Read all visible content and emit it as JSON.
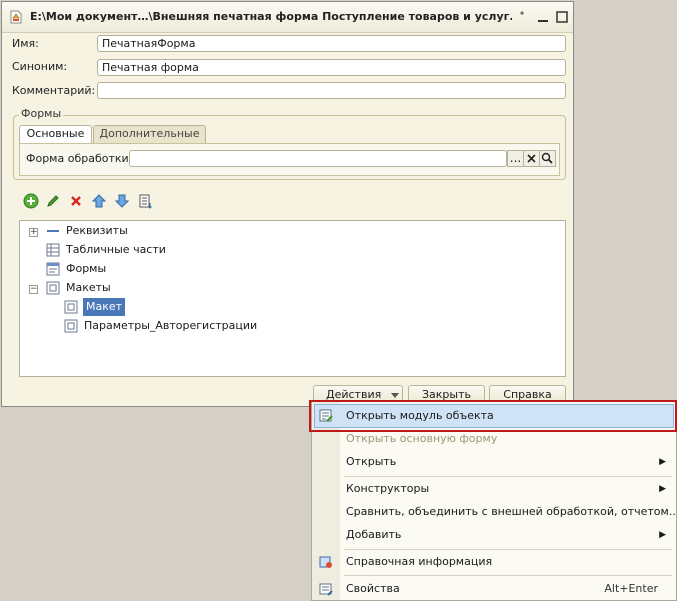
{
  "window": {
    "title": "E:\\Мои документ…\\Внешняя печатная форма Поступление товаров и услуг.epf *"
  },
  "fields": {
    "name_label": "Имя:",
    "name_value": "ПечатнаяФорма",
    "synonym_label": "Синоним:",
    "synonym_value": "Печатная форма",
    "comment_label": "Комментарий:",
    "comment_value": ""
  },
  "forms_group": {
    "title": "Формы",
    "tabs": [
      {
        "label": "Основные"
      },
      {
        "label": "Дополнительные"
      }
    ],
    "processing_form_label": "Форма обработки:",
    "processing_form_value": "",
    "select_button": "...",
    "clear_button": "✕",
    "open_button": "🔍"
  },
  "toolbar": {
    "icons": [
      "add-icon",
      "edit-icon",
      "delete-icon",
      "move-up-icon",
      "move-down-icon",
      "sort-icon"
    ]
  },
  "tree": {
    "items": [
      {
        "label": "Реквизиты",
        "icon": "attributes-icon",
        "expander": "+"
      },
      {
        "label": "Табличные части",
        "icon": "tabular-sections-icon"
      },
      {
        "label": "Формы",
        "icon": "forms-icon"
      },
      {
        "label": "Макеты",
        "icon": "templates-icon",
        "expander": "−"
      },
      {
        "label": "Макет",
        "icon": "template-icon",
        "selected": true
      },
      {
        "label": "Параметры_Авторегистрации",
        "icon": "template-icon"
      }
    ]
  },
  "buttons": {
    "actions": "Действия",
    "close": "Закрыть",
    "help": "Справка"
  },
  "context_menu": {
    "items": [
      {
        "label": "Открыть модуль объекта",
        "icon": "module-icon",
        "highlighted": true
      },
      {
        "label": "Открыть основную форму",
        "disabled": true
      },
      {
        "label": "Открыть",
        "submenu": true
      },
      {
        "label": "Конструкторы",
        "submenu": true
      },
      {
        "label": "Сравнить, объединить с внешней обработкой, отчетом..."
      },
      {
        "label": "Добавить",
        "submenu": true
      },
      {
        "label": "Справочная информация",
        "icon": "help-info-icon"
      },
      {
        "label": "Свойства",
        "icon": "properties-icon",
        "shortcut": "Alt+Enter"
      }
    ]
  },
  "colors": {
    "window_bg": "#f6f3e2",
    "desktop_bg": "#d4d0c8",
    "selection": "#4a77b8",
    "highlight_frame": "#c0191b"
  }
}
